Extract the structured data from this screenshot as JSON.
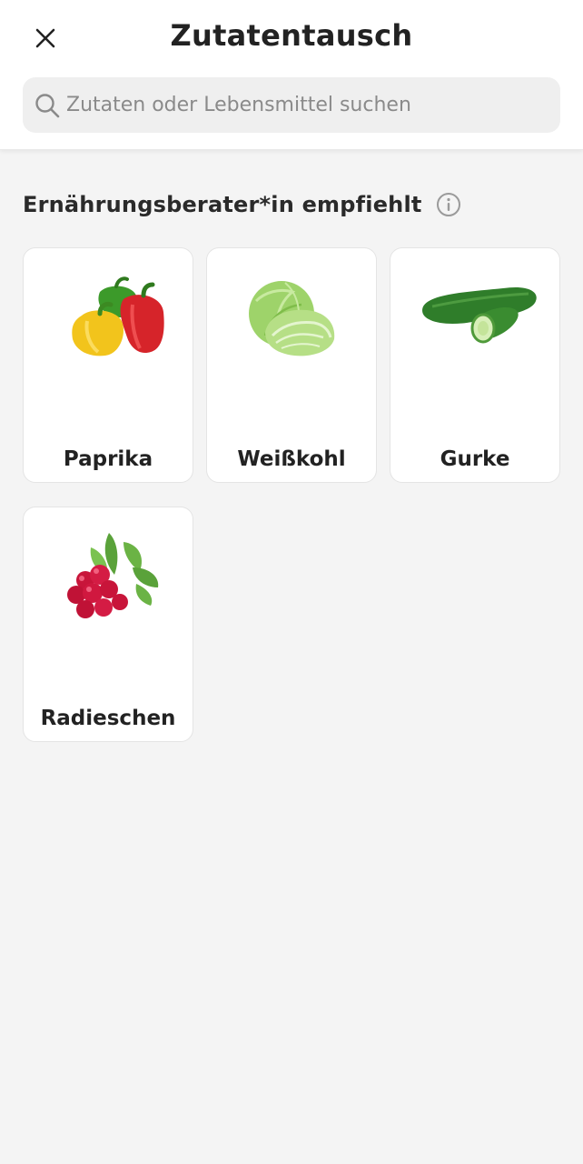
{
  "header": {
    "close_icon": "close-icon",
    "title": "Zutatentausch"
  },
  "search": {
    "icon": "search-icon",
    "placeholder": "Zutaten oder Lebensmittel suchen",
    "value": ""
  },
  "section": {
    "title": "Ernährungsberater*in empfiehlt",
    "info_icon": "info-icon"
  },
  "items": [
    {
      "label": "Paprika",
      "image": "bell-peppers"
    },
    {
      "label": "Weißkohl",
      "image": "white-cabbage"
    },
    {
      "label": "Gurke",
      "image": "cucumber"
    },
    {
      "label": "Radieschen",
      "image": "radishes"
    }
  ],
  "colors": {
    "background": "#f4f4f4",
    "card": "#ffffff",
    "search_bg": "#efefef",
    "text": "#222222"
  }
}
